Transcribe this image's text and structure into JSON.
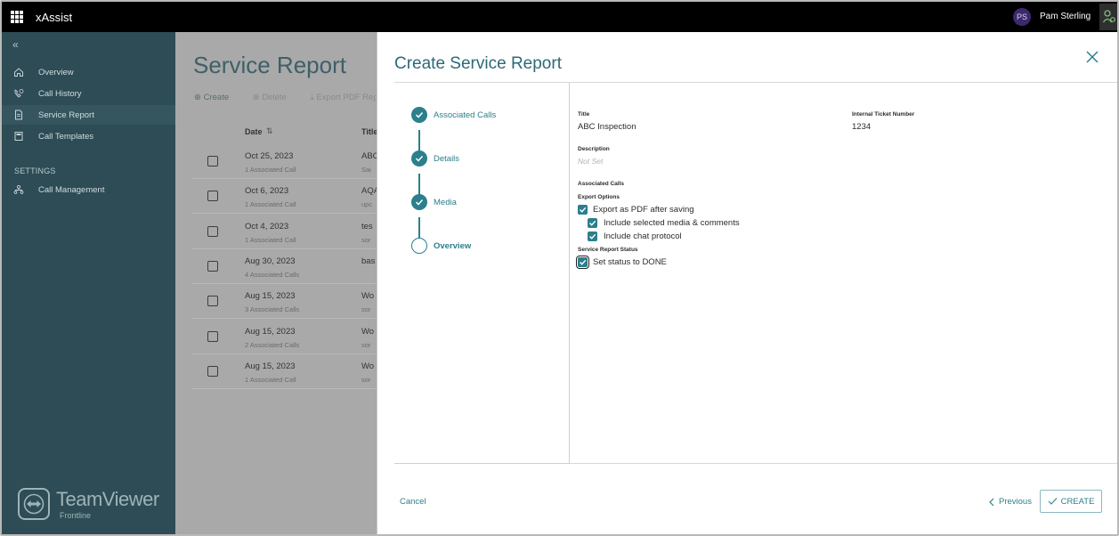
{
  "topbar": {
    "app_title": "xAssist",
    "user_initials": "PS",
    "user_name": "Pam Sterling"
  },
  "sidebar": {
    "items": [
      {
        "label": "Overview",
        "icon": "home-icon"
      },
      {
        "label": "Call History",
        "icon": "phone-history-icon"
      },
      {
        "label": "Service Report",
        "icon": "document-icon"
      },
      {
        "label": "Call Templates",
        "icon": "templates-icon"
      }
    ],
    "settings_heading": "SETTINGS",
    "settings_items": [
      {
        "label": "Call Management",
        "icon": "org-chart-icon"
      }
    ],
    "logo_name": "TeamViewer",
    "logo_sub": "Frontline"
  },
  "main": {
    "title": "Service Report",
    "toolbar": {
      "create": "Create",
      "delete": "Delete",
      "export": "Export PDF Reports"
    },
    "table": {
      "col_date": "Date",
      "col_title": "Title",
      "rows": [
        {
          "date": "Oct 25, 2023",
          "calls": "1 Associated Call",
          "title": "ABC",
          "sub": "Sai"
        },
        {
          "date": "Oct 6, 2023",
          "calls": "1 Associated Call",
          "title": "AQA",
          "sub": "upc"
        },
        {
          "date": "Oct 4, 2023",
          "calls": "1 Associated Call",
          "title": "tes",
          "sub": "sor"
        },
        {
          "date": "Aug 30, 2023",
          "calls": "4 Associated Calls",
          "title": "bas",
          "sub": ""
        },
        {
          "date": "Aug 15, 2023",
          "calls": "3 Associated Calls",
          "title": "Wo",
          "sub": "sor"
        },
        {
          "date": "Aug 15, 2023",
          "calls": "2 Associated Calls",
          "title": "Wo",
          "sub": "sor"
        },
        {
          "date": "Aug 15, 2023",
          "calls": "1 Associated Call",
          "title": "Wo",
          "sub": "sor"
        }
      ]
    }
  },
  "dialog": {
    "title": "Create Service Report",
    "steps": [
      {
        "label": "Associated Calls",
        "state": "done"
      },
      {
        "label": "Details",
        "state": "done"
      },
      {
        "label": "Media",
        "state": "done"
      },
      {
        "label": "Overview",
        "state": "current"
      }
    ],
    "fields": {
      "title_label": "Title",
      "title_value": "ABC Inspection",
      "ticket_label": "Internal Ticket Number",
      "ticket_value": "1234",
      "description_label": "Description",
      "description_value": "Not Set",
      "associated_calls_label": "Associated Calls",
      "export_options_label": "Export Options",
      "export_pdf": "Export as PDF after saving",
      "include_media": "Include selected media & comments",
      "include_chat": "Include chat protocol",
      "status_label": "Service Report Status",
      "set_done": "Set status to DONE"
    },
    "footer": {
      "cancel": "Cancel",
      "previous": "Previous",
      "create": "CREATE"
    }
  },
  "colors": {
    "accent": "#2c7f8c",
    "sidebar": "#2d4c55",
    "topbar": "#000000"
  }
}
